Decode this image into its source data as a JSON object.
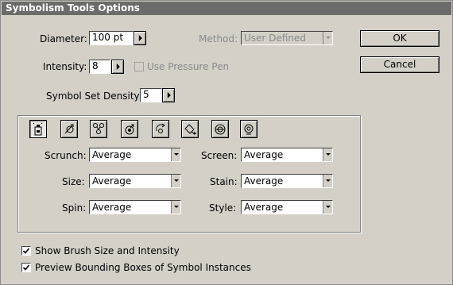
{
  "dialog": {
    "title": "Symbolism Tools Options"
  },
  "diameter": {
    "label": "Diameter:",
    "value": "100 pt"
  },
  "method": {
    "label": "Method:",
    "value": "User Defined"
  },
  "intensity": {
    "label": "Intensity:",
    "value": "8"
  },
  "pressure": {
    "label": "Use Pressure Pen",
    "checked": false,
    "enabled": false
  },
  "density": {
    "label": "Symbol Set Density:",
    "value": "5"
  },
  "buttons": {
    "ok": "OK",
    "cancel": "Cancel"
  },
  "tools": [
    "symbol-sprayer-icon",
    "symbol-shifter-icon",
    "symbol-scruncher-icon",
    "symbol-sizer-icon",
    "symbol-spinner-icon",
    "symbol-stainer-icon",
    "symbol-screener-icon",
    "symbol-styler-icon"
  ],
  "settings": {
    "scrunch": {
      "label": "Scrunch:",
      "value": "Average"
    },
    "size": {
      "label": "Size:",
      "value": "Average"
    },
    "spin": {
      "label": "Spin:",
      "value": "Average"
    },
    "screen": {
      "label": "Screen:",
      "value": "Average"
    },
    "stain": {
      "label": "Stain:",
      "value": "Average"
    },
    "style": {
      "label": "Style:",
      "value": "Average"
    }
  },
  "options": {
    "show_brush": {
      "label": "Show Brush Size and Intensity",
      "checked": true
    },
    "preview_bbox": {
      "label": "Preview Bounding Boxes of Symbol Instances",
      "checked": true
    }
  }
}
